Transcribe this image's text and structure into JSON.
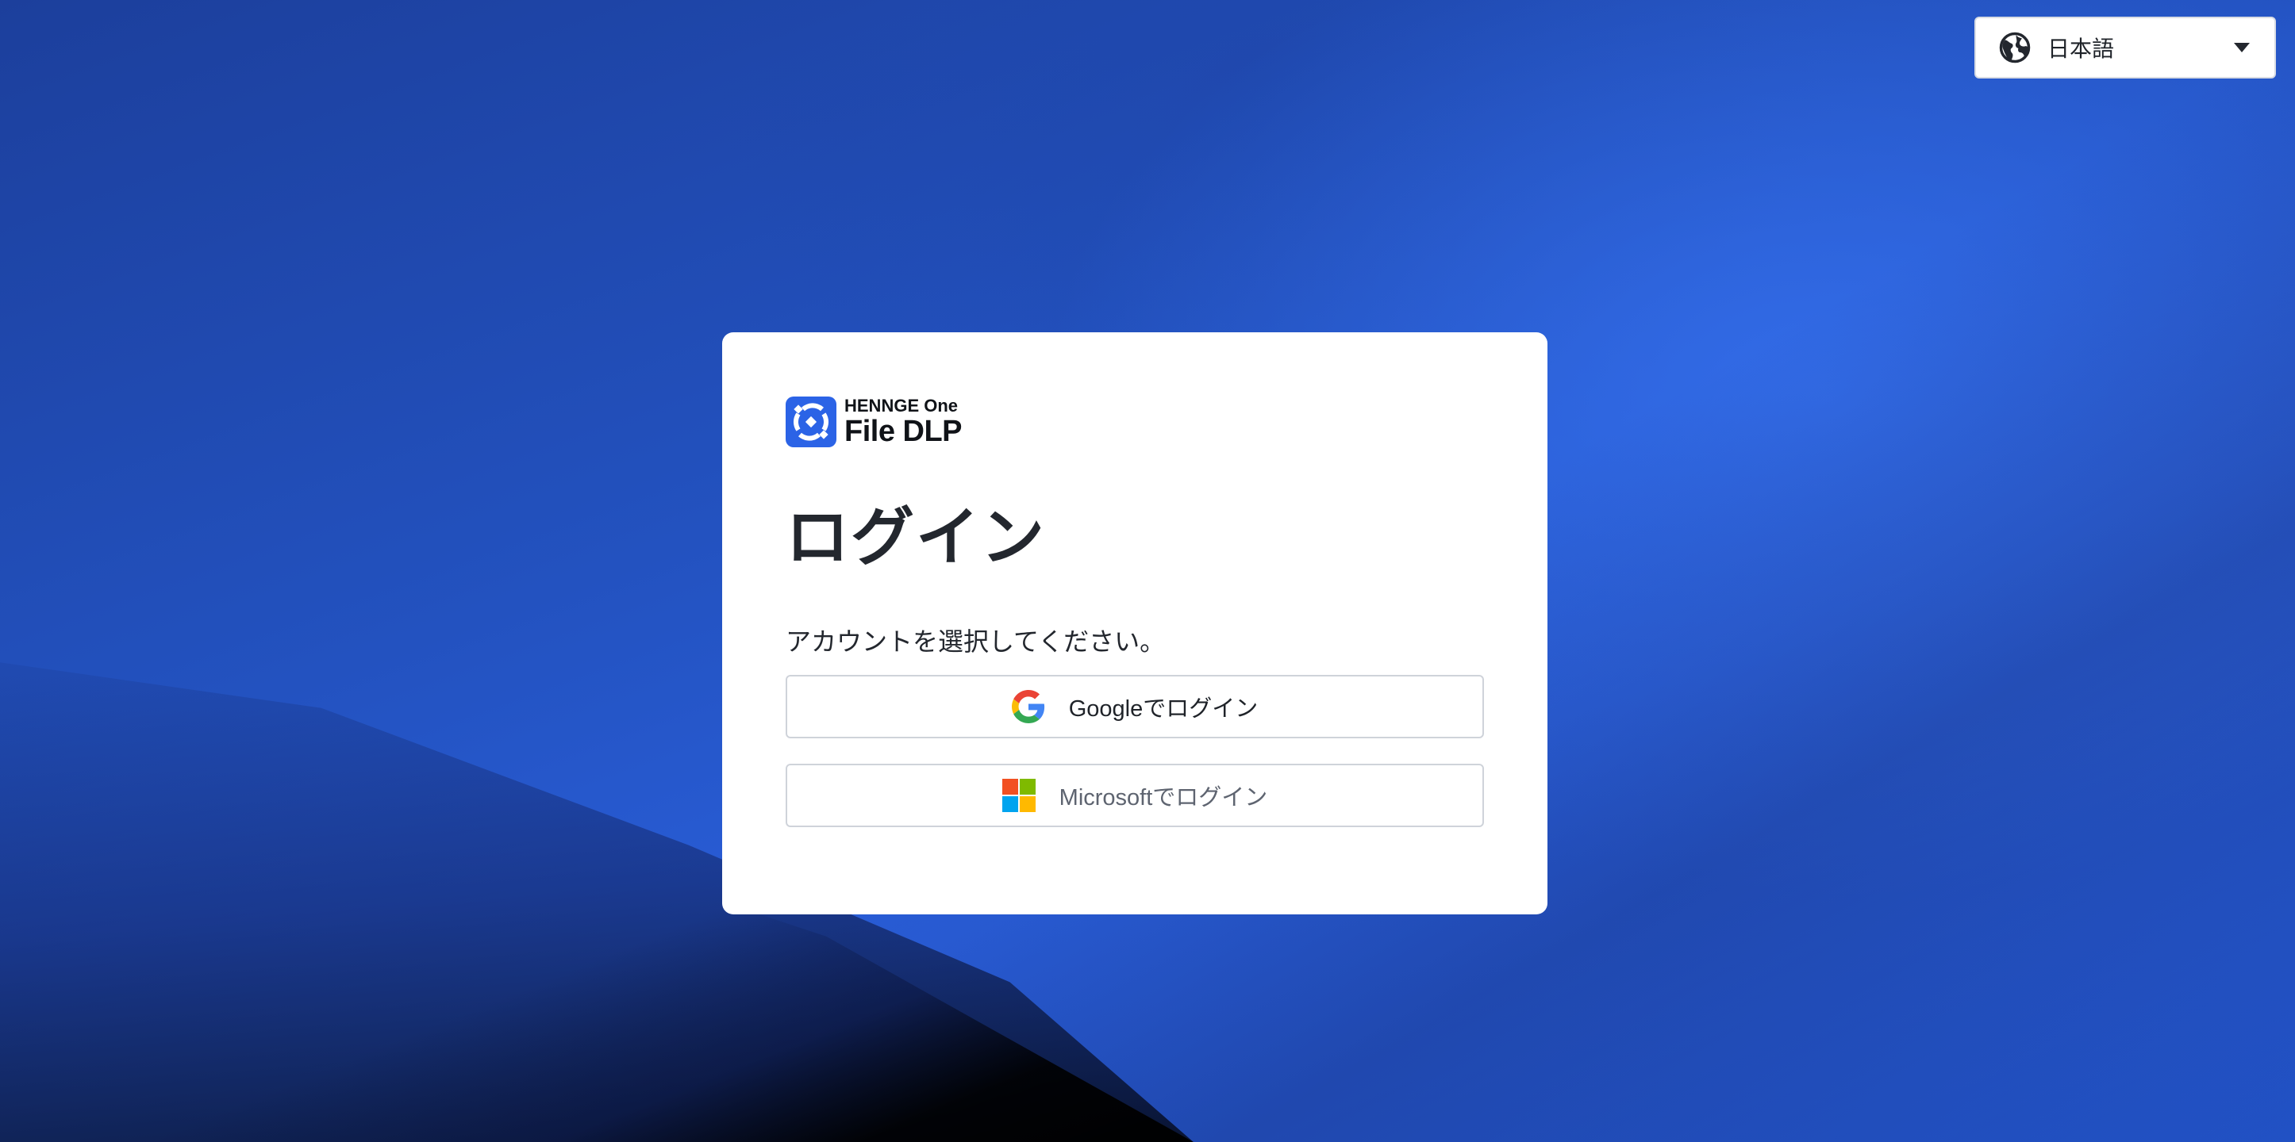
{
  "language_selector": {
    "icon": "globe-icon",
    "selected": "日本語",
    "caret_icon": "caret-down-icon"
  },
  "card": {
    "brand": {
      "logo_icon": "henngeone-logo-icon",
      "suite_name": "HENNGE One",
      "product_name": "File DLP"
    },
    "title": "ログイン",
    "instruction": "アカウントを選択してください。",
    "buttons": [
      {
        "id": "google",
        "icon": "google-icon",
        "label": "Googleでログイン"
      },
      {
        "id": "microsoft",
        "icon": "microsoft-icon",
        "label": "Microsoftでログイン"
      }
    ]
  },
  "colors": {
    "brand_blue": "#2b63e6",
    "background_blue": "#2352c0",
    "card_bg": "#ffffff",
    "text_primary": "#23272e",
    "google_blue": "#4285F4",
    "google_red": "#EA4335",
    "google_yellow": "#FBBC05",
    "google_green": "#34A853",
    "ms_red": "#F25022",
    "ms_green": "#7FBA00",
    "ms_blue": "#00A4EF",
    "ms_yellow": "#FFB900"
  }
}
